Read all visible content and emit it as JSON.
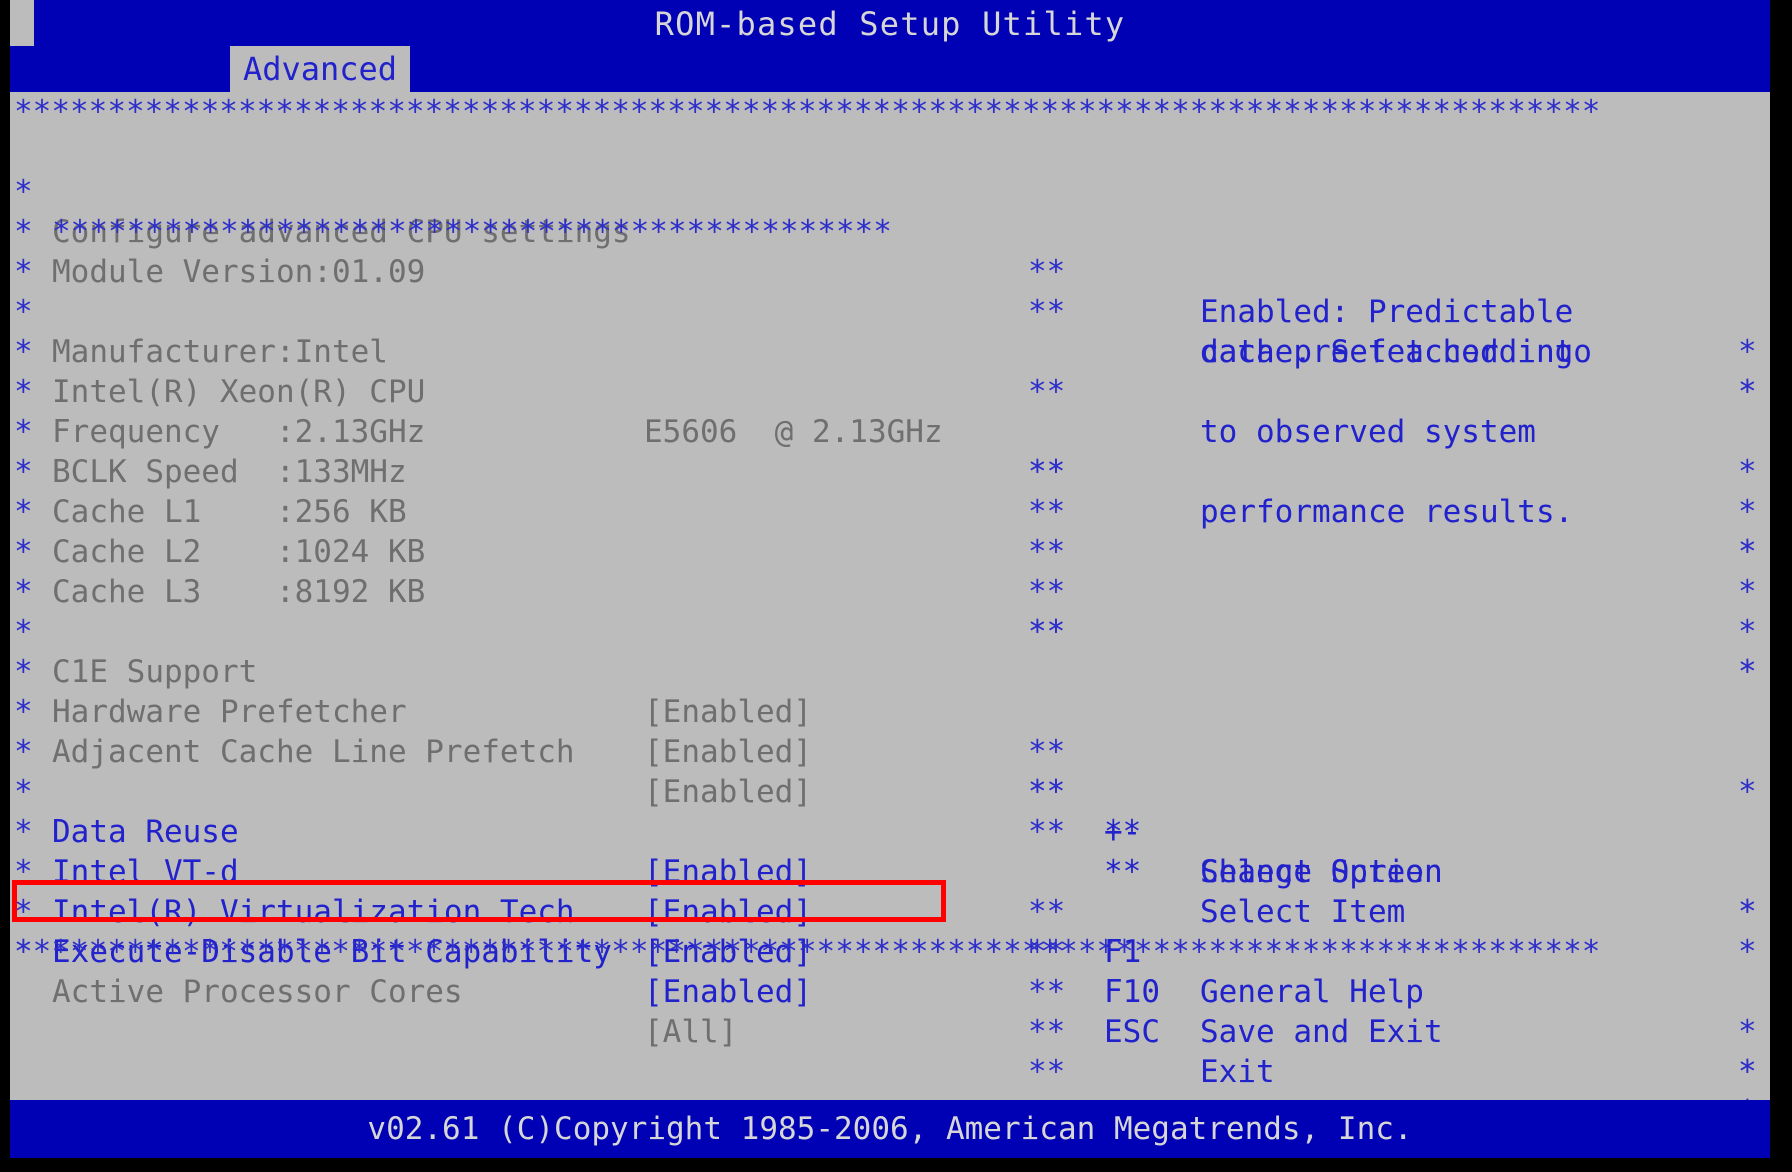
{
  "window": {
    "title": "ROM-based Setup Utility",
    "active_tab": "Advanced",
    "cursor_icon": "block-cursor"
  },
  "separators": {
    "full": "*************************************************************************************",
    "indent": "*********************************************"
  },
  "main": {
    "section_title": "Configure advanced CPU settings",
    "module_version_label": "Module Version:01.09",
    "info_rows": [
      {
        "label": "Manufacturer:Intel",
        "value": ""
      },
      {
        "label": "Intel(R) Xeon(R) CPU",
        "value": "E5606  @ 2.13GHz"
      },
      {
        "label": "Frequency   :2.13GHz",
        "value": ""
      },
      {
        "label": "BCLK Speed  :133MHz",
        "value": ""
      },
      {
        "label": "Cache L1    :256 KB",
        "value": ""
      },
      {
        "label": "Cache L2    :1024 KB",
        "value": ""
      },
      {
        "label": "Cache L3    :8192 KB",
        "value": ""
      }
    ],
    "settings": [
      {
        "label": "C1E Support",
        "value": "[Enabled]",
        "highlighted": false,
        "selected": false
      },
      {
        "label": "Hardware Prefetcher",
        "value": "[Enabled]",
        "highlighted": false,
        "selected": false
      },
      {
        "label": "Adjacent Cache Line Prefetch",
        "value": "[Enabled]",
        "highlighted": false,
        "selected": false
      },
      {
        "label": "Data Reuse",
        "value": "[Enabled]",
        "highlighted": true,
        "selected": false
      },
      {
        "label": "Intel VT-d",
        "value": "[Enabled]",
        "highlighted": true,
        "selected": true
      },
      {
        "label": "Intel(R) Virtualization Tech",
        "value": "[Enabled]",
        "highlighted": true,
        "selected": false
      },
      {
        "label": "Execute-Disable Bit Capability",
        "value": "[Enabled]",
        "highlighted": true,
        "selected": false
      },
      {
        "label": "Active Processor Cores",
        "value": "[All]",
        "highlighted": false,
        "selected": false
      }
    ]
  },
  "help_panel": {
    "lines": [
      "Enabled: Predictable",
      "data pre-fetched into",
      "cache. Set according",
      "to observed system",
      "performance results."
    ]
  },
  "nav_keys": [
    {
      "key": "**",
      "action": "Select Screen",
      "icon": "left-right-arrow-icon"
    },
    {
      "key": "**",
      "action": "Select Item",
      "icon": "up-down-arrow-icon"
    },
    {
      "key": "+-",
      "action": "Change Option",
      "icon": "plus-minus-icon"
    },
    {
      "key": "F1",
      "action": "General Help",
      "icon": "f1-key-icon"
    },
    {
      "key": "F10",
      "action": "Save and Exit",
      "icon": "f10-key-icon"
    },
    {
      "key": "ESC",
      "action": "Exit",
      "icon": "esc-key-icon"
    }
  ],
  "footer": {
    "copyright": "v02.61 (C)Copyright 1985-2006, American Megatrends, Inc."
  },
  "colors": {
    "blue_bg": "#0000b5",
    "gray_bg": "#bcbcbc",
    "blue_text": "#2222cc",
    "dim_text": "#6f6f6f",
    "light_text": "#d6d6d6",
    "highlight_box": "#ff0000"
  }
}
